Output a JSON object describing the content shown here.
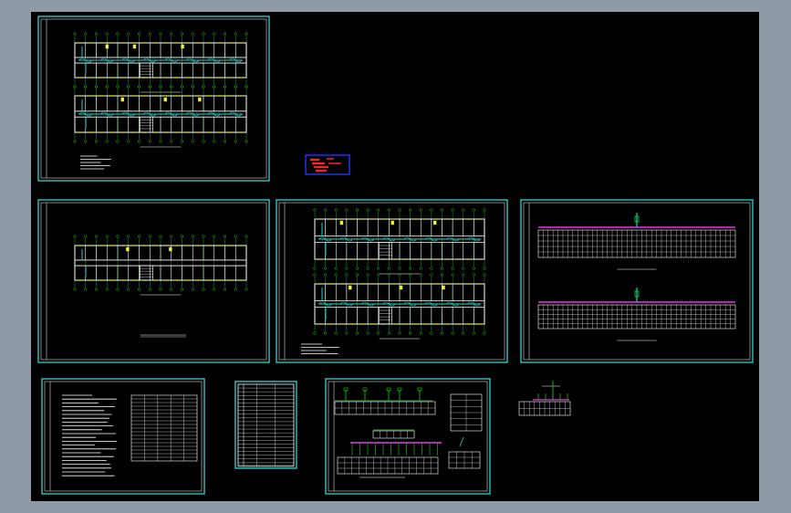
{
  "app": {
    "background_color": "#8f9aa6",
    "canvas_color": "#000000"
  },
  "palette": {
    "sheet_frame": "#2ec6c6",
    "line_white": "#ffffff",
    "grid_green": "#19d019",
    "pipe_cyan": "#1fd6d6",
    "equipment_yellow": "#f2f22a",
    "pipe_magenta": "#e63ce6",
    "stamp_blue": "#1a2cff",
    "stamp_red": "#ff2020"
  },
  "sheets": [
    {
      "id": "sheet-1",
      "content": "double-floor-plan"
    },
    {
      "id": "sheet-2",
      "content": "floor-plan"
    },
    {
      "id": "sheet-3",
      "content": "double-floor-plan-piping"
    },
    {
      "id": "sheet-4",
      "content": "riser-diagrams"
    },
    {
      "id": "sheet-5",
      "content": "notes-and-legend"
    },
    {
      "id": "sheet-6",
      "content": "material-table"
    },
    {
      "id": "sheet-7",
      "content": "system-diagrams"
    },
    {
      "id": "sheet-8",
      "content": "small-detail"
    }
  ],
  "stamp": {
    "icon": "title-stamp"
  }
}
